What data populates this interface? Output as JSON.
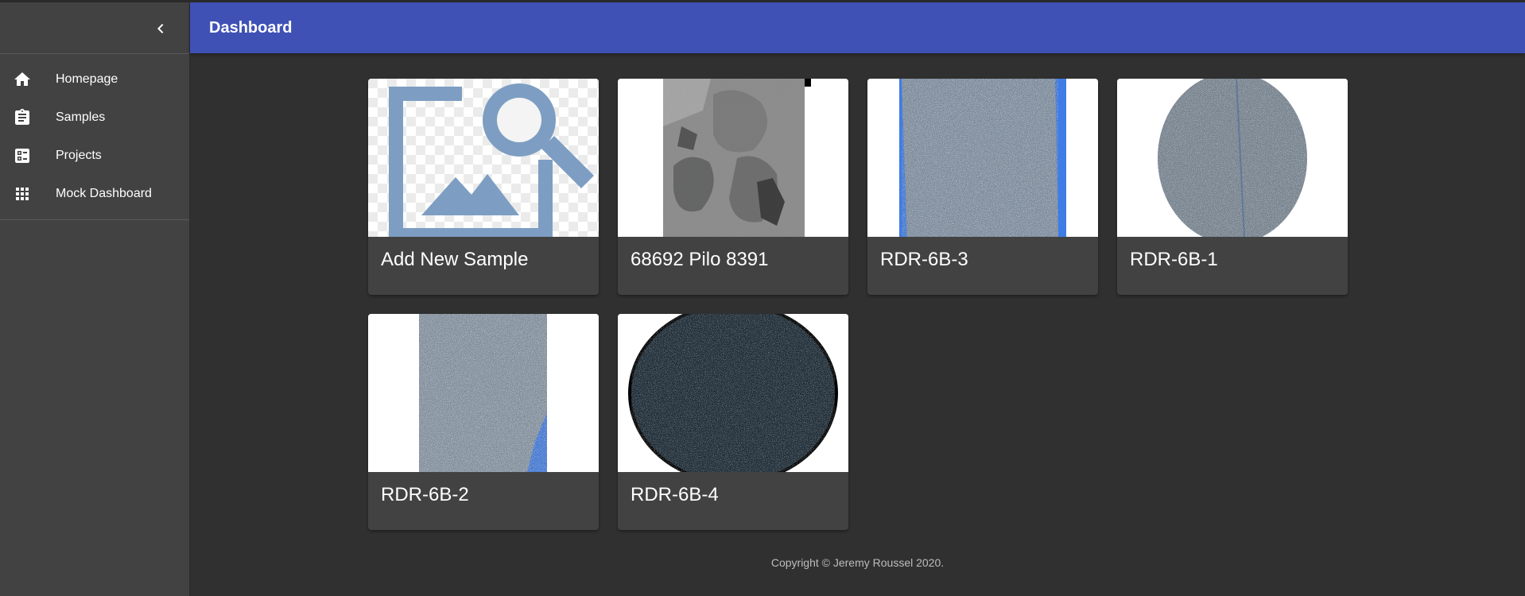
{
  "app": {
    "title": "Dashboard"
  },
  "sidebar": {
    "collapse_icon": "chevron-left-icon",
    "items": [
      {
        "label": "Homepage",
        "icon": "home-icon"
      },
      {
        "label": "Samples",
        "icon": "clipboard-icon"
      },
      {
        "label": "Projects",
        "icon": "checklist-icon"
      },
      {
        "label": "Mock Dashboard",
        "icon": "grid-icon"
      }
    ]
  },
  "cards": [
    {
      "title": "Add New Sample",
      "image": "add-image-search-icon"
    },
    {
      "title": "68692 Pilo 8391",
      "image": "grayscale-rock-section"
    },
    {
      "title": "RDR-6B-3",
      "image": "speckled-rock-rectangle"
    },
    {
      "title": "RDR-6B-1",
      "image": "speckled-rock-circle"
    },
    {
      "title": "RDR-6B-2",
      "image": "speckled-rock-rectangle"
    },
    {
      "title": "RDR-6B-4",
      "image": "dark-speckled-circle"
    }
  ],
  "footer": {
    "text": "Copyright © Jeremy Roussel 2020."
  },
  "colors": {
    "appbar": "#3f51b5",
    "background": "#303030",
    "sidebar": "#424242",
    "card": "#424242",
    "placeholder_icon": "#7d9ec2",
    "rock_blue": "#3f7ce6"
  }
}
